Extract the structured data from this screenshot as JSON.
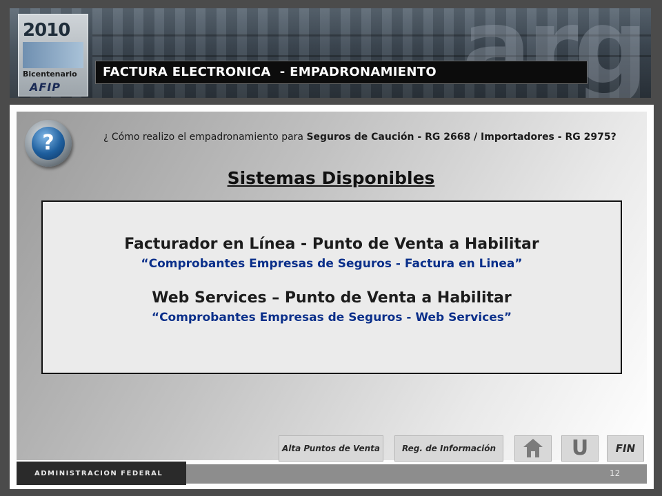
{
  "header": {
    "logo": {
      "year": "2010",
      "label": "Bicentenario",
      "org": "AFIP"
    },
    "arg_watermark": "arg",
    "title": "FACTURA ELECTRONICA  - EMPADRONAMIENTO"
  },
  "question": {
    "prefix": "¿ Cómo realizo el empadronamiento para ",
    "emphasis": "Seguros de Caución - RG 2668 / Importadores - RG 2975?"
  },
  "section_title": "Sistemas Disponibles",
  "content": {
    "line1": "Facturador en Línea - Punto de Venta a Habilitar",
    "line2": "“Comprobantes Empresas de Seguros - Factura en Linea”",
    "line3": "Web Services – Punto de Venta a Habilitar",
    "line4": "“Comprobantes Empresas de Seguros - Web Services”"
  },
  "nav": {
    "alta_label": "Alta Puntos de Venta",
    "reg_label": "Reg. de Información",
    "home_icon": "home-icon",
    "back_icon": "back-icon",
    "fin_label": "FIN"
  },
  "footer": {
    "org_name": "ADMINISTRACION FEDERAL",
    "page_number": "12"
  },
  "colors": {
    "link_blue": "#0a2f8a",
    "title_bar": "#0c0c0c"
  }
}
